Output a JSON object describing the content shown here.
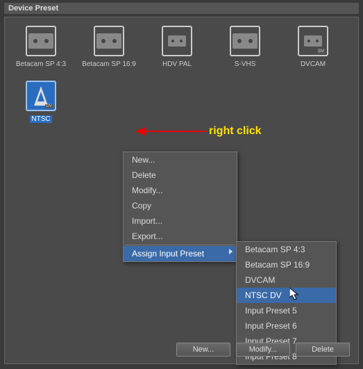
{
  "panel": {
    "title": "Device Preset"
  },
  "presets": [
    {
      "label": "Betacam SP 4:3",
      "kind": "tape"
    },
    {
      "label": "Betacam SP 16:9",
      "kind": "tape"
    },
    {
      "label": "HDV PAL",
      "kind": "tape-small"
    },
    {
      "label": "S-VHS",
      "kind": "tape"
    },
    {
      "label": "DVCAM",
      "kind": "tape-small-dv"
    },
    {
      "label": "NTSC",
      "kind": "tower",
      "selected": true
    }
  ],
  "annotation": {
    "text": "right click"
  },
  "context_menu": {
    "items": [
      {
        "label": "New..."
      },
      {
        "label": "Delete"
      },
      {
        "label": "Modify..."
      },
      {
        "label": "Copy"
      },
      {
        "label": "Import..."
      },
      {
        "label": "Export..."
      }
    ],
    "submenu_trigger": "Assign Input Preset",
    "submenu": [
      "Betacam SP 4:3",
      "Betacam SP 16:9",
      "DVCAM",
      "NTSC DV",
      "Input Preset 5",
      "Input Preset 6",
      "Input Preset 7",
      "Input Preset 8"
    ],
    "submenu_hover": "NTSC DV"
  },
  "buttons": {
    "new": "New...",
    "modify": "Modify...",
    "delete": "Delete"
  }
}
